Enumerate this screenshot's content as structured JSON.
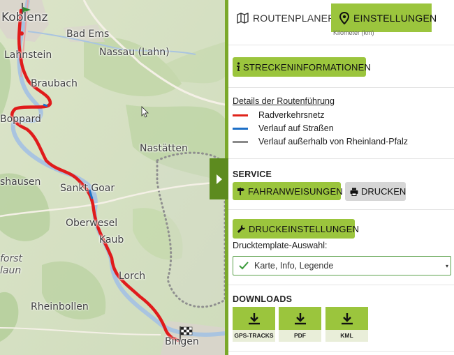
{
  "map": {
    "places": [
      {
        "name": "Koblenz"
      },
      {
        "name": "Bad Ems"
      },
      {
        "name": "Lahnstein"
      },
      {
        "name": "Nassau (Lahn)"
      },
      {
        "name": "Braubach"
      },
      {
        "name": "Boppard"
      },
      {
        "name": "Nastätten"
      },
      {
        "name": "shausen"
      },
      {
        "name": "Sankt Goar"
      },
      {
        "name": "Oberwesel"
      },
      {
        "name": "Kaub"
      },
      {
        "name": "Lorch"
      },
      {
        "name": "Rheinbollen"
      },
      {
        "name": "Bingen"
      },
      {
        "name": "forst"
      },
      {
        "name": "laun"
      }
    ],
    "route_color": "#e01b1b"
  },
  "tabs": {
    "routenplaner": "ROUTENPLANER",
    "einstellungen": "EINSTELLUNGEN"
  },
  "clipped_text": "Kilometer (km)",
  "streckeninfo_label": "STRECKENINFORMATIONEN",
  "details": {
    "title": "Details der Routenführung",
    "legend": [
      {
        "label": "Radverkehrsnetz",
        "color": "#e0241b"
      },
      {
        "label": "Verlauf auf Straßen",
        "color": "#1d6fc7"
      },
      {
        "label": "Verlauf außerhalb von Rheinland-Pfalz",
        "color": "#8a8a8a"
      }
    ]
  },
  "service": {
    "title": "SERVICE",
    "fahranweisungen_label": "FAHRANWEISUNGEN",
    "drucken_label": "DRUCKEN"
  },
  "druck": {
    "button_label": "DRUCKEINSTELLUNGEN",
    "template_label": "Drucktemplate-Auswahl:",
    "template_value": "Karte, Info, Legende"
  },
  "downloads": {
    "title": "DOWNLOADS",
    "items": [
      {
        "label": "GPS-TRACKS"
      },
      {
        "label": "PDF"
      },
      {
        "label": "KML"
      }
    ]
  },
  "colors": {
    "accent": "#9bc53d",
    "dark_green": "#5d8b1f"
  }
}
